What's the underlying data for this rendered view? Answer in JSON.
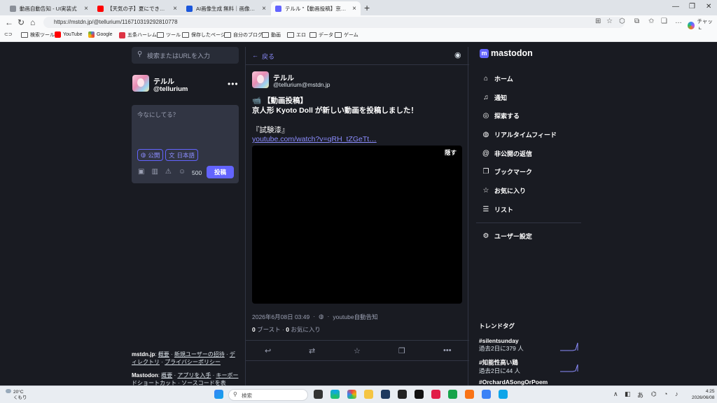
{
  "browser": {
    "tabs": [
      {
        "label": "動画自動告知 - UI実装式",
        "color": "#8a8f98"
      },
      {
        "label": "【天気の子】夏にできることはまだあるか",
        "color": "#ff0000"
      },
      {
        "label": "AI画像生成 無料｜画像変換ができる",
        "color": "#1a56db"
      },
      {
        "label": "テルル \"【動画投稿】京人形 Kyo",
        "color": "#6364ff"
      }
    ],
    "url": "https://mstdn.jp/@tellurium/116710319292810778",
    "copilot_label": "チャット",
    "bookmarks": [
      "検索ツール",
      "YouTube",
      "Google",
      "五条ハーレム",
      "ツール",
      "保存したページ",
      "自分のブログ",
      "動画",
      "エロ",
      "データ",
      "ゲーム"
    ]
  },
  "left": {
    "search_placeholder": "検索またはURLを入力",
    "account_name": "テルル",
    "account_handle": "@tellurium",
    "compose_placeholder": "今なにしてる？",
    "visibility": "公開",
    "language": "日本語",
    "char_count": "500",
    "post_button": "投稿",
    "footer_site": "mstdn.jp",
    "footer_site_links": [
      "概要",
      "新規ユーザーの招待",
      "ディレクトリ",
      "プライバシーポリシー"
    ],
    "footer_app": "Mastodon",
    "footer_app_links": [
      "概要",
      "アプリを入手",
      "キーボードショートカット",
      "ソースコードを表"
    ]
  },
  "center": {
    "back_label": "戻る",
    "author_name": "テルル",
    "author_handle": "@tellurium@mstdn.jp",
    "line1": "【動画投稿】",
    "line2": "京人形 Kyoto Doll が新しい動画を投稿しました！",
    "line3": "『試験漆』",
    "link": "youtube.com/watch?v=qRH_tZGeTt…",
    "hide_label": "隠す",
    "timestamp": "2026年6月08日 03:49",
    "app": "youtube自動告知",
    "boost_count": "0",
    "boost_label": "ブースト",
    "fav_count": "0",
    "fav_label": "お気に入り"
  },
  "right": {
    "brand": "mastodon",
    "nav": [
      {
        "label": "ホーム",
        "icon": "home-icon",
        "glyph": "⌂"
      },
      {
        "label": "通知",
        "icon": "bell-icon",
        "glyph": "♫"
      },
      {
        "label": "探索する",
        "icon": "compass-icon",
        "glyph": "◎"
      },
      {
        "label": "リアルタイムフィード",
        "icon": "globe-icon",
        "glyph": "◍"
      },
      {
        "label": "非公開の返信",
        "icon": "at-icon",
        "glyph": "@"
      },
      {
        "label": "ブックマーク",
        "icon": "bookmark-icon",
        "glyph": "❐"
      },
      {
        "label": "お気に入り",
        "icon": "star-icon",
        "glyph": "☆"
      },
      {
        "label": "リスト",
        "icon": "list-icon",
        "glyph": "☰"
      }
    ],
    "settings_label": "ユーザー設定",
    "trends_title": "トレンドタグ",
    "trends": [
      {
        "tag": "#silentsunday",
        "count": "過去2日に379 人"
      },
      {
        "tag": "#知能性高い鶏",
        "count": "過去2日に44 人"
      },
      {
        "tag": "#OrchardASongOrPoem",
        "count": ""
      }
    ]
  },
  "taskbar": {
    "weather_temp": "20°C",
    "weather_desc": "くもり",
    "search_placeholder": "検索",
    "ime": "あ",
    "time": "4:25",
    "date": "2026/06/08"
  }
}
